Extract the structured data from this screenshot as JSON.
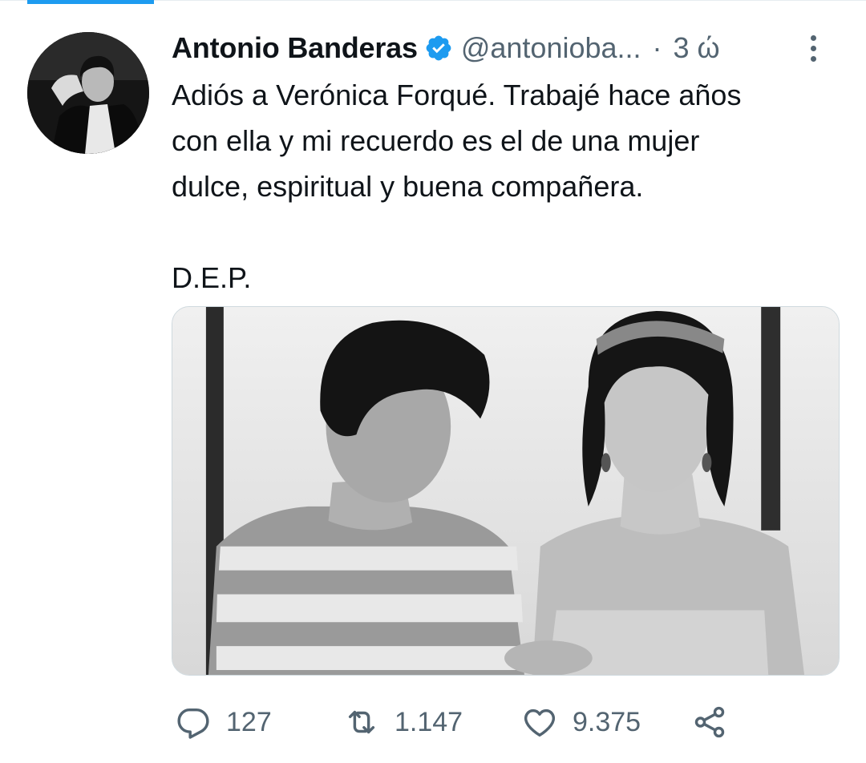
{
  "tweet": {
    "display_name": "Antonio Banderas",
    "handle": "@antonioba...",
    "separator": "·",
    "time": "3 ώ",
    "text": "Adiós a Verónica Forqué. Trabajé hace años\ncon ella y mi recuerdo es el de una mujer\ndulce, espiritual y buena compañera.\n\nD.E.P.",
    "verified": true
  },
  "icons": {
    "verified": "verified-badge-icon",
    "more": "more-vertical-icon",
    "reply": "reply-icon",
    "retweet": "retweet-icon",
    "like": "like-heart-icon",
    "share": "share-icon"
  },
  "actions": {
    "reply_count": "127",
    "retweet_count": "1.147",
    "like_count": "9.375"
  },
  "colors": {
    "accent": "#1d9bf0",
    "text": "#0f1419",
    "muted": "#536471"
  }
}
